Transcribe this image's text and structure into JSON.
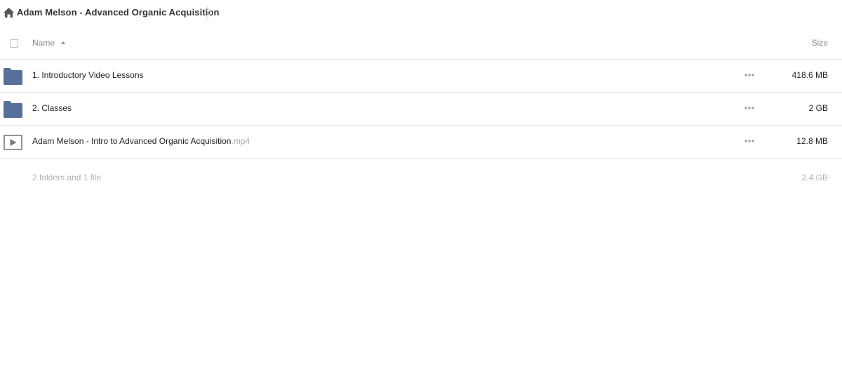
{
  "breadcrumb": {
    "home_icon": "home-icon",
    "title": "Adam Melson - Advanced Organic Acquisition"
  },
  "header": {
    "name_label": "Name",
    "size_label": "Size",
    "sort_direction": "ascending"
  },
  "items": [
    {
      "type": "folder",
      "icon": "folder-icon",
      "name": "1. Introductory Video Lessons",
      "ext": "",
      "size": "418.6 MB"
    },
    {
      "type": "folder",
      "icon": "folder-icon",
      "name": "2. Classes",
      "ext": "",
      "size": "2 GB"
    },
    {
      "type": "file",
      "icon": "video-file-icon",
      "name": "Adam Melson - Intro to Advanced Organic Acquisition",
      "ext": ".mp4",
      "size": "12.8 MB"
    }
  ],
  "summary": {
    "count": "2 folders and 1 file",
    "total_size": "2.4 GB"
  },
  "colors": {
    "folder": "#56709a",
    "text": "#222222",
    "muted": "#b0b0b0",
    "divider": "#e6e6e6"
  }
}
